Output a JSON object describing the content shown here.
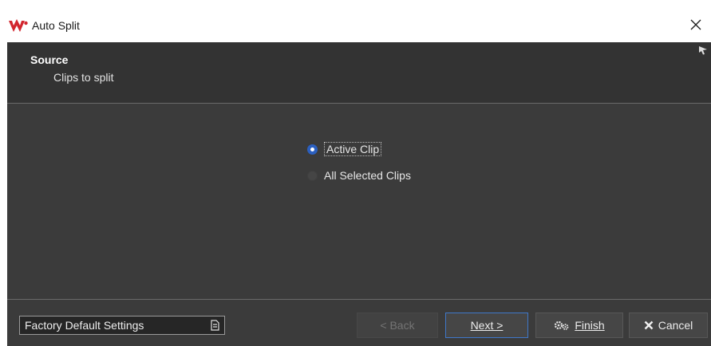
{
  "window": {
    "title": "Auto Split",
    "close_icon": "close-icon",
    "app_icon": "wavelab-logo-icon"
  },
  "header": {
    "title": "Source",
    "subtitle": "Clips to split"
  },
  "options": [
    {
      "label": "Active Clip",
      "selected": true
    },
    {
      "label": "All Selected Clips",
      "selected": false
    }
  ],
  "footer": {
    "preset_label": "Factory Default Settings",
    "back_label": "< Back",
    "next_label": "Next >",
    "finish_label": "Finish",
    "cancel_label": "Cancel"
  },
  "colors": {
    "panel_bg": "#3b3b3b",
    "header_bg": "#333333",
    "accent": "#2b5fbf",
    "logo_red": "#d2262e"
  }
}
